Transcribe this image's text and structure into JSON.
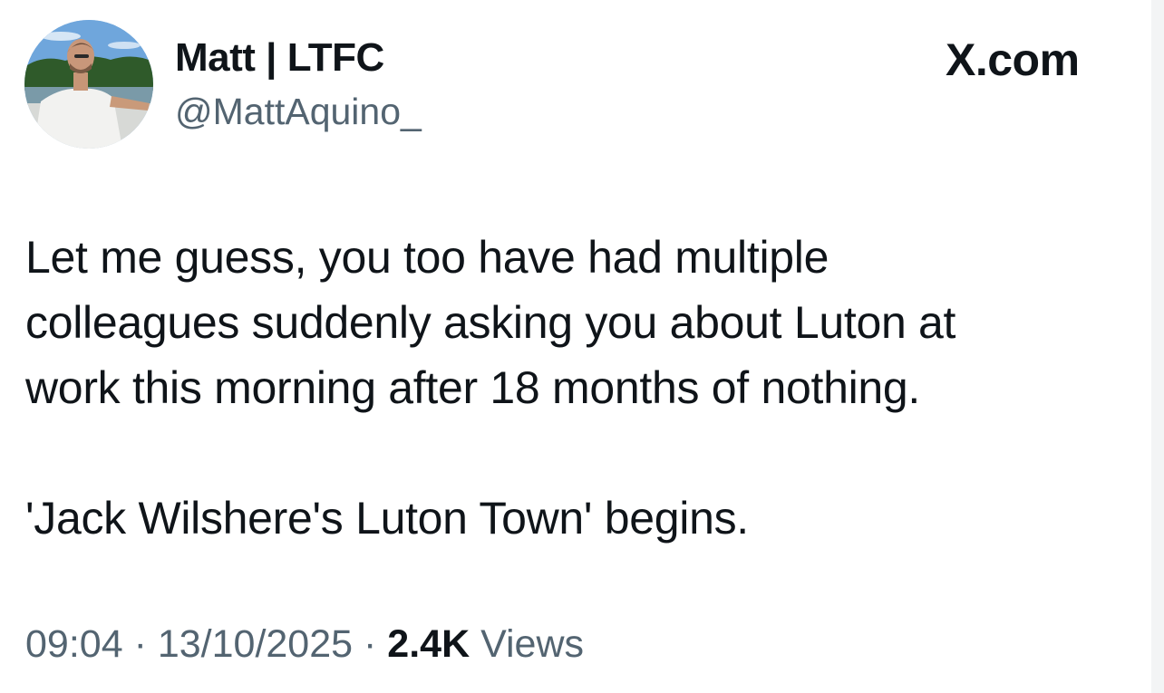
{
  "author": {
    "display_name": "Matt | LTFC",
    "handle": "@MattAquino_",
    "avatar": "profile-photo"
  },
  "brand": "X.com",
  "tweet": {
    "lines": [
      "Let me guess, you too have had multiple",
      "colleagues suddenly asking you about Luton at",
      "work this morning after 18 months of nothing."
    ],
    "second_paragraph": "'Jack Wilshere's Luton Town' begins."
  },
  "meta": {
    "time": "09:04",
    "separator": "·",
    "date": "13/10/2025",
    "views_count": "2.4K",
    "views_label": "Views"
  },
  "colors": {
    "text": "#0f1419",
    "secondary": "#536471",
    "background": "#ffffff"
  }
}
